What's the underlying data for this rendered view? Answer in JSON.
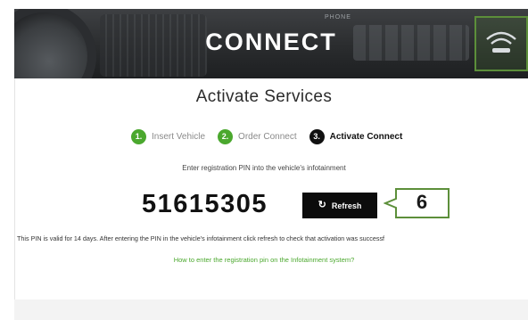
{
  "hero": {
    "title": "CONNECT",
    "phone_tag": "PHONE"
  },
  "page": {
    "title": "Activate Services"
  },
  "steps": [
    {
      "num": "1.",
      "label": "Insert Vehicle",
      "state": "done"
    },
    {
      "num": "2.",
      "label": "Order Connect",
      "state": "done"
    },
    {
      "num": "3.",
      "label": "Activate Connect",
      "state": "active"
    }
  ],
  "instruction": "Enter registration PIN into the vehicle's infotainment",
  "pin": "51615305",
  "refresh": {
    "icon": "refresh-icon",
    "label": "Refresh"
  },
  "callout": {
    "number": "6",
    "color": "#5c8f3a"
  },
  "note": "This PIN is valid for 14 days. After entering the PIN in the vehicle's infotainment click refresh to check that activation was successf",
  "howto_link": "How to enter the registration pin on the Infotainment system?",
  "colors": {
    "accent_green": "#4ba82e",
    "button_black": "#0c0c0c"
  }
}
